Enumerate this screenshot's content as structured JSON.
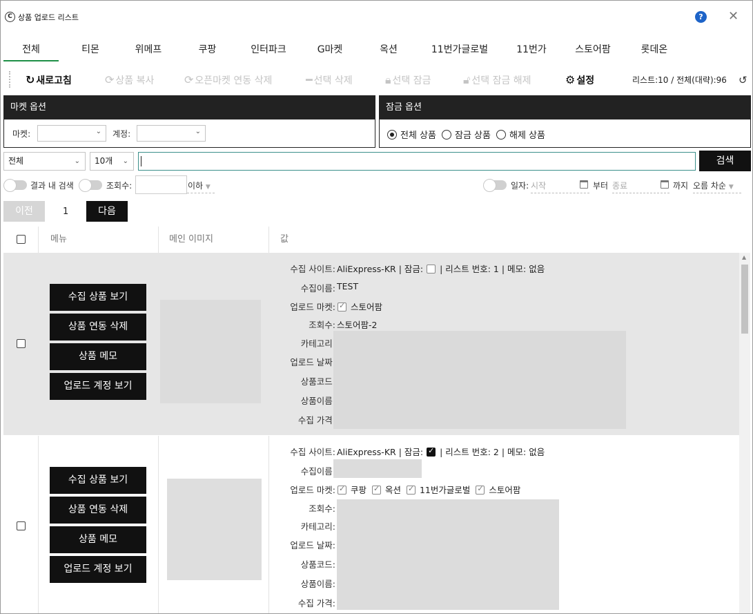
{
  "window": {
    "title": "상품 업로드 리스트",
    "help_glyph": "?",
    "close_glyph": "✕",
    "logo_glyph": "C"
  },
  "tabs": [
    "전체",
    "티몬",
    "위메프",
    "쿠팡",
    "인터파크",
    "G마켓",
    "옥션",
    "11번가글로벌",
    "11번가",
    "스토어팜",
    "롯데온"
  ],
  "active_tab": 0,
  "toolbar": {
    "refresh": "새로고침",
    "copy": "상품 복사",
    "openmarket_delete": "오픈마켓 연동 삭제",
    "select_delete": "선택 삭제",
    "select_lock": "선택 잠금",
    "select_unlock": "선택 잠금 해제",
    "settings": "설정",
    "list_info": "리스트:10  /  전체(대략):96"
  },
  "market_options": {
    "title": "마켓 옵션",
    "market_label": "마켓:",
    "account_label": "계정:"
  },
  "lock_options": {
    "title": "잠금 옵션",
    "all": "전체 상품",
    "locked": "잠금 상품",
    "unlocked": "해제 상품",
    "selected": "all"
  },
  "search": {
    "scope": "전체",
    "count": "10개",
    "button": "검색"
  },
  "filters": {
    "in_result": "결과 내 검색",
    "views_label": "조회수:",
    "views_cmp": "이하",
    "date_label": "일자:",
    "start": "시작",
    "from": "부터",
    "end": "종료",
    "to": "까지",
    "sort": "오름 차순"
  },
  "paging": {
    "prev": "이전",
    "page": "1",
    "next": "다음"
  },
  "table": {
    "col_menu": "메뉴",
    "col_image": "메인 이미지",
    "col_value": "값"
  },
  "row_actions": [
    "수집 상품 보기",
    "상품 연동 삭제",
    "상품 메모",
    "업로드 계정 보기"
  ],
  "field_labels": {
    "site": "수집 사이트:",
    "name": "수집이름:",
    "market": "업로드 마켓:",
    "views": "조회수:",
    "category": "카테고리:",
    "date": "업로드 날짜:",
    "code": "상품코드:",
    "pname": "상품이름:",
    "price": "수집 가격:",
    "lock": "| 잠금:",
    "list_no": "| 리스트 번호:",
    "memo": "| 메모:"
  },
  "rows": [
    {
      "site": "AliExpress-KR",
      "locked": false,
      "list_no": "1",
      "memo": "없음",
      "name": "TEST",
      "markets": [
        "스토어팜"
      ],
      "views": "스토어팜-2"
    },
    {
      "site": "AliExpress-KR",
      "locked": true,
      "list_no": "2",
      "memo": "없음",
      "name": "",
      "markets": [
        "쿠팡",
        "옥션",
        "11번가글로벌",
        "스토어팜"
      ],
      "views": ""
    }
  ],
  "icons": {
    "refresh": "refresh-icon",
    "copy": "sync-icon",
    "delete": "minus-icon",
    "lock": "lock-icon",
    "unlock": "unlock-icon",
    "settings": "gear-icon",
    "calendar": "calendar-icon"
  }
}
